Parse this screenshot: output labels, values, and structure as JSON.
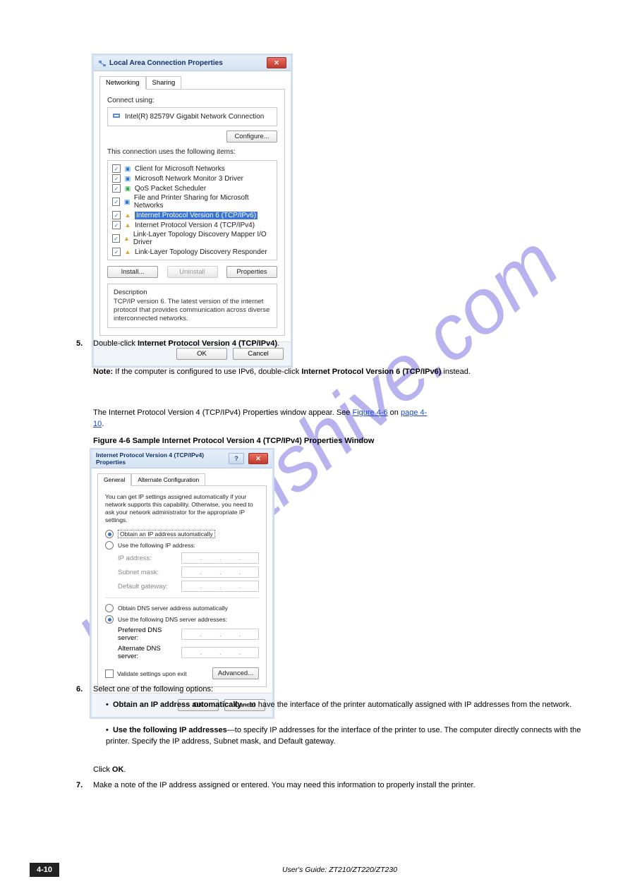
{
  "watermark": "manualshive.com",
  "dialog1": {
    "title": "Local Area Connection Properties",
    "tabs": [
      "Networking",
      "Sharing"
    ],
    "connect_using_label": "Connect using:",
    "adapter": "Intel(R) 82579V Gigabit Network Connection",
    "configure_btn": "Configure...",
    "uses_label": "This connection uses the following items:",
    "items": [
      {
        "label": "Client for Microsoft Networks",
        "icon_color": "#2d76d6"
      },
      {
        "label": "Microsoft Network Monitor 3 Driver",
        "icon_color": "#2d76d6"
      },
      {
        "label": "QoS Packet Scheduler",
        "icon_color": "#36a84a"
      },
      {
        "label": "File and Printer Sharing for Microsoft Networks",
        "icon_color": "#2d76d6"
      },
      {
        "label": "Internet Protocol Version 6 (TCP/IPv6)",
        "icon_color": "#e2a330",
        "selected": true
      },
      {
        "label": "Internet Protocol Version 4 (TCP/IPv4)",
        "icon_color": "#e2a330"
      },
      {
        "label": "Link-Layer Topology Discovery Mapper I/O Driver",
        "icon_color": "#e2a330"
      },
      {
        "label": "Link-Layer Topology Discovery Responder",
        "icon_color": "#e2a330"
      }
    ],
    "install_btn": "Install...",
    "uninstall_btn": "Uninstall",
    "properties_btn": "Properties",
    "description_label": "Description",
    "description_text": "TCP/IP version 6. The latest version of the internet protocol that provides communication across diverse interconnected networks.",
    "ok_btn": "OK",
    "cancel_btn": "Cancel"
  },
  "para_step5": {
    "num": "5.",
    "line1": "Double-click ",
    "bold1": "Internet Protocol Version 4 (TCP/IPv4)",
    "line2": ".",
    "note_head": "Note:",
    "note_body": " If the computer is configured to use IPv6, double-click ",
    "bold2": "Internet Protocol Version 6 (TCP/IPv6)",
    "note_tail": " instead.",
    "line3a": "The Internet Protocol Version 4 (TCP/IPv4) Properties window appear. See ",
    "link1": "Figure 4-6",
    "line3b": " on ",
    "link2": "page 4-",
    "link3": "10",
    "line3c": "."
  },
  "figure_label": "Figure 4-6   Sample Internet Protocol Version 4 (TCP/IPv4) Properties Window",
  "dialog2": {
    "title": "Internet Protocol Version 4 (TCP/IPv4) Properties",
    "tabs": [
      "General",
      "Alternate Configuration"
    ],
    "intro": "You can get IP settings assigned automatically if your network supports this capability. Otherwise, you need to ask your network administrator for the appropriate IP settings.",
    "r_auto_ip": "Obtain an IP address automatically",
    "r_use_ip": "Use the following IP address:",
    "f_ip": "IP address:",
    "f_mask": "Subnet mask:",
    "f_gw": "Default gateway:",
    "r_auto_dns": "Obtain DNS server address automatically",
    "r_use_dns": "Use the following DNS server addresses:",
    "f_pref": "Preferred DNS server:",
    "f_alt": "Alternate DNS server:",
    "validate": "Validate settings upon exit",
    "advanced_btn": "Advanced...",
    "ok_btn": "OK",
    "cancel_btn": "Cancel"
  },
  "para_step6": {
    "num": "6.",
    "line1_a": "Select one of the following options:",
    "opt1_head": "Obtain an IP address automatically",
    "opt1_body": "—to have the interface of the printer automatically assigned with IP addresses from the network.",
    "opt2_head": "Use the following IP addresses",
    "opt2_body": "—to specify IP addresses for the interface of the printer to use. The computer directly connects with the printer. Specify the IP address, Subnet mask, and Default gateway.",
    "click": "Click ",
    "ok": "OK",
    "period": "."
  },
  "para_step7": {
    "num": "7.",
    "text": "Make a note of the IP address assigned or entered. You may need this information to properly install the printer."
  },
  "page_number": "4-10",
  "footer": "User's Guide: ZT210/ZT220/ZT230"
}
